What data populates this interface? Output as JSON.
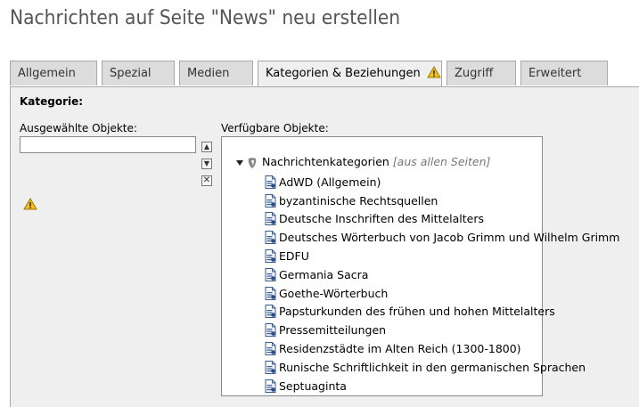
{
  "page": {
    "title": "Nachrichten auf Seite \"News\" neu erstellen"
  },
  "tabs": [
    {
      "label": "Allgemein"
    },
    {
      "label": "Spezial"
    },
    {
      "label": "Medien"
    },
    {
      "label": "Kategorien & Beziehungen",
      "active": true,
      "icon": "warning-icon"
    },
    {
      "label": "Zugriff"
    },
    {
      "label": "Erweitert"
    }
  ],
  "form": {
    "section_label": "Kategorie:",
    "selected_label": "Ausgewählte Objekte:",
    "selected_value": "",
    "available_label": "Verfügbare Objekte:"
  },
  "tree": {
    "root_label": "Nachrichtenkategorien",
    "root_hint": "[aus allen Seiten]",
    "items": [
      "AdWD (Allgemein)",
      "byzantinische Rechtsquellen",
      "Deutsche Inschriften des Mittelalters",
      "Deutsches Wörterbuch von Jacob Grimm und Wilhelm Grimm",
      "EDFU",
      "Germania Sacra",
      "Goethe-Wörterbuch",
      "Papsturkunden des frühen und hohen Mittelalters",
      "Pressemitteilungen",
      "Residenzstädte im Alten Reich (1300-1800)",
      "Runische Schriftlichkeit in den germanischen Sprachen",
      "Septuaginta"
    ]
  },
  "colors": {
    "warning": "#f0c020",
    "panel": "#efefef",
    "tab": "#dcdcdc"
  }
}
